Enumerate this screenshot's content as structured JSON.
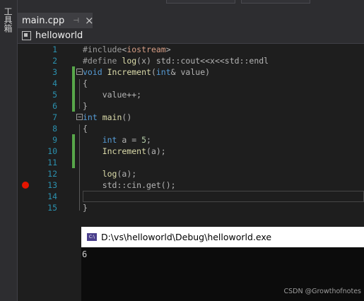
{
  "toolbox": {
    "label": "工具箱"
  },
  "tab": {
    "label": "main.cpp",
    "pin_glyph": "⊣",
    "close_glyph": "×"
  },
  "navbar": {
    "project_label": "helloworld"
  },
  "editor": {
    "lines": [
      {
        "number": "1",
        "parts": [
          {
            "c": "pp",
            "t": "#include"
          },
          {
            "c": "p",
            "t": "<"
          },
          {
            "c": "s",
            "t": "iostream"
          },
          {
            "c": "p",
            "t": ">"
          }
        ]
      },
      {
        "number": "2",
        "parts": [
          {
            "c": "pp",
            "t": "#define "
          },
          {
            "c": "f",
            "t": "log"
          },
          {
            "c": "p",
            "t": "(x) std::cout<<x<<std::endl"
          }
        ]
      },
      {
        "number": "3",
        "parts": [
          {
            "c": "k",
            "t": "void "
          },
          {
            "c": "f",
            "t": "Increment"
          },
          {
            "c": "p",
            "t": "("
          },
          {
            "c": "k",
            "t": "int"
          },
          {
            "c": "p",
            "t": "& value)"
          }
        ]
      },
      {
        "number": "4",
        "parts": [
          {
            "c": "p",
            "t": "{"
          }
        ]
      },
      {
        "number": "5",
        "parts": [
          {
            "c": "p",
            "t": "    value++;"
          }
        ]
      },
      {
        "number": "6",
        "parts": [
          {
            "c": "p",
            "t": "}"
          }
        ]
      },
      {
        "number": "7",
        "parts": [
          {
            "c": "k",
            "t": "int "
          },
          {
            "c": "f",
            "t": "main"
          },
          {
            "c": "p",
            "t": "()"
          }
        ]
      },
      {
        "number": "8",
        "parts": [
          {
            "c": "p",
            "t": "{"
          }
        ]
      },
      {
        "number": "9",
        "parts": [
          {
            "c": "k",
            "t": "    int "
          },
          {
            "c": "p",
            "t": "a = "
          },
          {
            "c": "n",
            "t": "5"
          },
          {
            "c": "p",
            "t": ";"
          }
        ]
      },
      {
        "number": "10",
        "parts": [
          {
            "c": "f",
            "t": "    Increment"
          },
          {
            "c": "p",
            "t": "(a);"
          }
        ]
      },
      {
        "number": "11",
        "parts": []
      },
      {
        "number": "12",
        "parts": [
          {
            "c": "f",
            "t": "    log"
          },
          {
            "c": "p",
            "t": "(a);"
          }
        ]
      },
      {
        "number": "13",
        "parts": [
          {
            "c": "p",
            "t": "    std::cin.get();"
          }
        ]
      },
      {
        "number": "14",
        "parts": []
      },
      {
        "number": "15",
        "parts": [
          {
            "c": "p",
            "t": "}"
          }
        ]
      }
    ],
    "changed_lines": [
      "3",
      "4",
      "5",
      "6",
      "9",
      "10",
      "11"
    ],
    "folded_starts": [
      "3",
      "7"
    ],
    "breakpoint_line": "13",
    "cursor_line": "14"
  },
  "console": {
    "icon_text": "C:\\",
    "title": "D:\\vs\\helloworld\\Debug\\helloworld.exe",
    "output": "6"
  },
  "watermark": "CSDN @Growthofnotes"
}
